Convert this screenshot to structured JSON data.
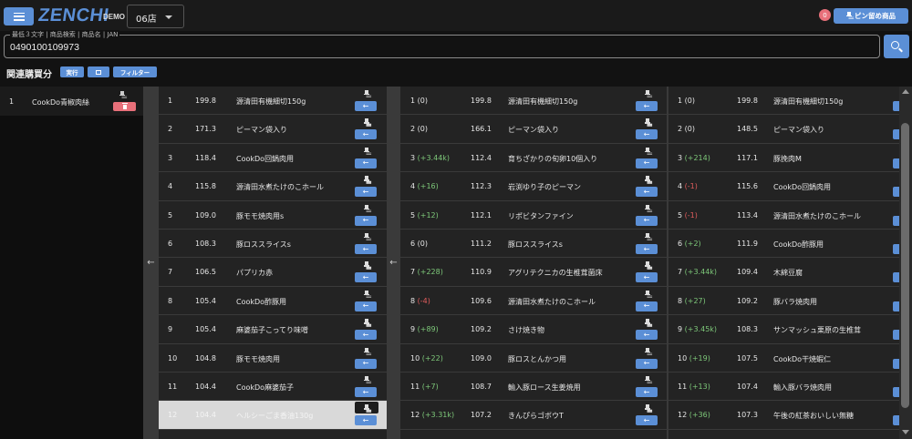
{
  "header": {
    "menu_icon": "hamburger-icon",
    "logo_text": "ZENCHI",
    "logo_badge": "DEMO",
    "store_value": "06店",
    "notification_count": "0",
    "pinned_label": "ピン留め商品",
    "pinned_icon": "pin-icon"
  },
  "search": {
    "legend": "最低３文字 | 商品検索 | 商品名 | JAN",
    "value": "0490100109973",
    "button_icon": "search-icon"
  },
  "related": {
    "title": "関連購買分",
    "run_label": "実行",
    "copy_icon": "square-icon",
    "filter_label": "フィルター"
  },
  "selected": [
    {
      "rank": "1",
      "name": "CookDo青椒肉絲"
    }
  ],
  "panel1": [
    {
      "rank": "1",
      "score": "199.8",
      "name": "源清田有機細切150g"
    },
    {
      "rank": "2",
      "score": "171.3",
      "name": "ピーマン袋入り"
    },
    {
      "rank": "3",
      "score": "118.4",
      "name": "CookDo回鍋肉用"
    },
    {
      "rank": "4",
      "score": "115.8",
      "name": "源清田水煮たけのこホール"
    },
    {
      "rank": "5",
      "score": "109.0",
      "name": "豚モモ焼肉用s"
    },
    {
      "rank": "6",
      "score": "108.3",
      "name": "豚ロススライスs"
    },
    {
      "rank": "7",
      "score": "106.5",
      "name": "パプリカ赤"
    },
    {
      "rank": "8",
      "score": "105.4",
      "name": "CookDo酢豚用"
    },
    {
      "rank": "9",
      "score": "105.4",
      "name": "麻婆茄子こってり味噌"
    },
    {
      "rank": "10",
      "score": "104.8",
      "name": "豚モモ焼肉用"
    },
    {
      "rank": "11",
      "score": "104.4",
      "name": "CookDo麻婆茄子"
    },
    {
      "rank": "12",
      "score": "104.4",
      "name": "ヘルシーごま香油130g"
    }
  ],
  "panel2": [
    {
      "rank": "1",
      "delta": "(0)",
      "tone": "neutral",
      "score": "199.8",
      "name": "源清田有機細切150g"
    },
    {
      "rank": "2",
      "delta": "(0)",
      "tone": "neutral",
      "score": "166.1",
      "name": "ピーマン袋入り"
    },
    {
      "rank": "3",
      "delta": "(+3.44k)",
      "tone": "pos",
      "score": "112.4",
      "name": "育ちざかりの旬卵10個入り"
    },
    {
      "rank": "4",
      "delta": "(+16)",
      "tone": "pos",
      "score": "112.3",
      "name": "岩渕ゆり子のピーマン"
    },
    {
      "rank": "5",
      "delta": "(+12)",
      "tone": "pos",
      "score": "112.1",
      "name": "リポビタンファイン"
    },
    {
      "rank": "6",
      "delta": "(0)",
      "tone": "neutral",
      "score": "111.2",
      "name": "豚ロススライスs"
    },
    {
      "rank": "7",
      "delta": "(+228)",
      "tone": "pos",
      "score": "110.9",
      "name": "アグリテクニカの生椎茸菌床"
    },
    {
      "rank": "8",
      "delta": "(-4)",
      "tone": "neg",
      "score": "109.6",
      "name": "源清田水煮たけのこホール"
    },
    {
      "rank": "9",
      "delta": "(+89)",
      "tone": "pos",
      "score": "109.2",
      "name": "さけ焼き物"
    },
    {
      "rank": "10",
      "delta": "(+22)",
      "tone": "pos",
      "score": "109.0",
      "name": "豚ロスとんかつ用"
    },
    {
      "rank": "11",
      "delta": "(+7)",
      "tone": "pos",
      "score": "108.7",
      "name": "輸入豚ロース生姜焼用"
    },
    {
      "rank": "12",
      "delta": "(+3.31k)",
      "tone": "pos",
      "score": "107.2",
      "name": "きんぴらゴボウT"
    }
  ],
  "panel3": [
    {
      "rank": "1",
      "delta": "(0)",
      "tone": "neutral",
      "score": "199.8",
      "name": "源清田有機細切150g"
    },
    {
      "rank": "2",
      "delta": "(0)",
      "tone": "neutral",
      "score": "148.5",
      "name": "ピーマン袋入り"
    },
    {
      "rank": "3",
      "delta": "(+214)",
      "tone": "pos",
      "score": "117.1",
      "name": "豚挽肉M"
    },
    {
      "rank": "4",
      "delta": "(-1)",
      "tone": "neg",
      "score": "115.6",
      "name": "CookDo回鍋肉用"
    },
    {
      "rank": "5",
      "delta": "(-1)",
      "tone": "neg",
      "score": "113.4",
      "name": "源清田水煮たけのこホール"
    },
    {
      "rank": "6",
      "delta": "(+2)",
      "tone": "pos",
      "score": "111.9",
      "name": "CookDo酢豚用"
    },
    {
      "rank": "7",
      "delta": "(+3.44k)",
      "tone": "pos",
      "score": "109.4",
      "name": "木綿豆腐"
    },
    {
      "rank": "8",
      "delta": "(+27)",
      "tone": "pos",
      "score": "109.2",
      "name": "豚バラ焼肉用"
    },
    {
      "rank": "9",
      "delta": "(+3.45k)",
      "tone": "pos",
      "score": "108.3",
      "name": "サンマッシュ栗原の生椎茸"
    },
    {
      "rank": "10",
      "delta": "(+19)",
      "tone": "pos",
      "score": "107.5",
      "name": "CookDo干焼蝦仁"
    },
    {
      "rank": "11",
      "delta": "(+13)",
      "tone": "pos",
      "score": "107.4",
      "name": "輸入豚バラ焼肉用"
    },
    {
      "rank": "12",
      "delta": "(+36)",
      "tone": "pos",
      "score": "107.3",
      "name": "午後の紅茶おいしい無糖"
    }
  ],
  "colors": {
    "accent": "#5b8fd6",
    "danger": "#e8707a",
    "positive": "#7ec97a",
    "negative": "#e35d5d"
  },
  "icons": {
    "pin": "pin-icon",
    "go": "arrow-left-icon",
    "delete": "trash-icon",
    "collapse": "chevron-left-icon"
  }
}
